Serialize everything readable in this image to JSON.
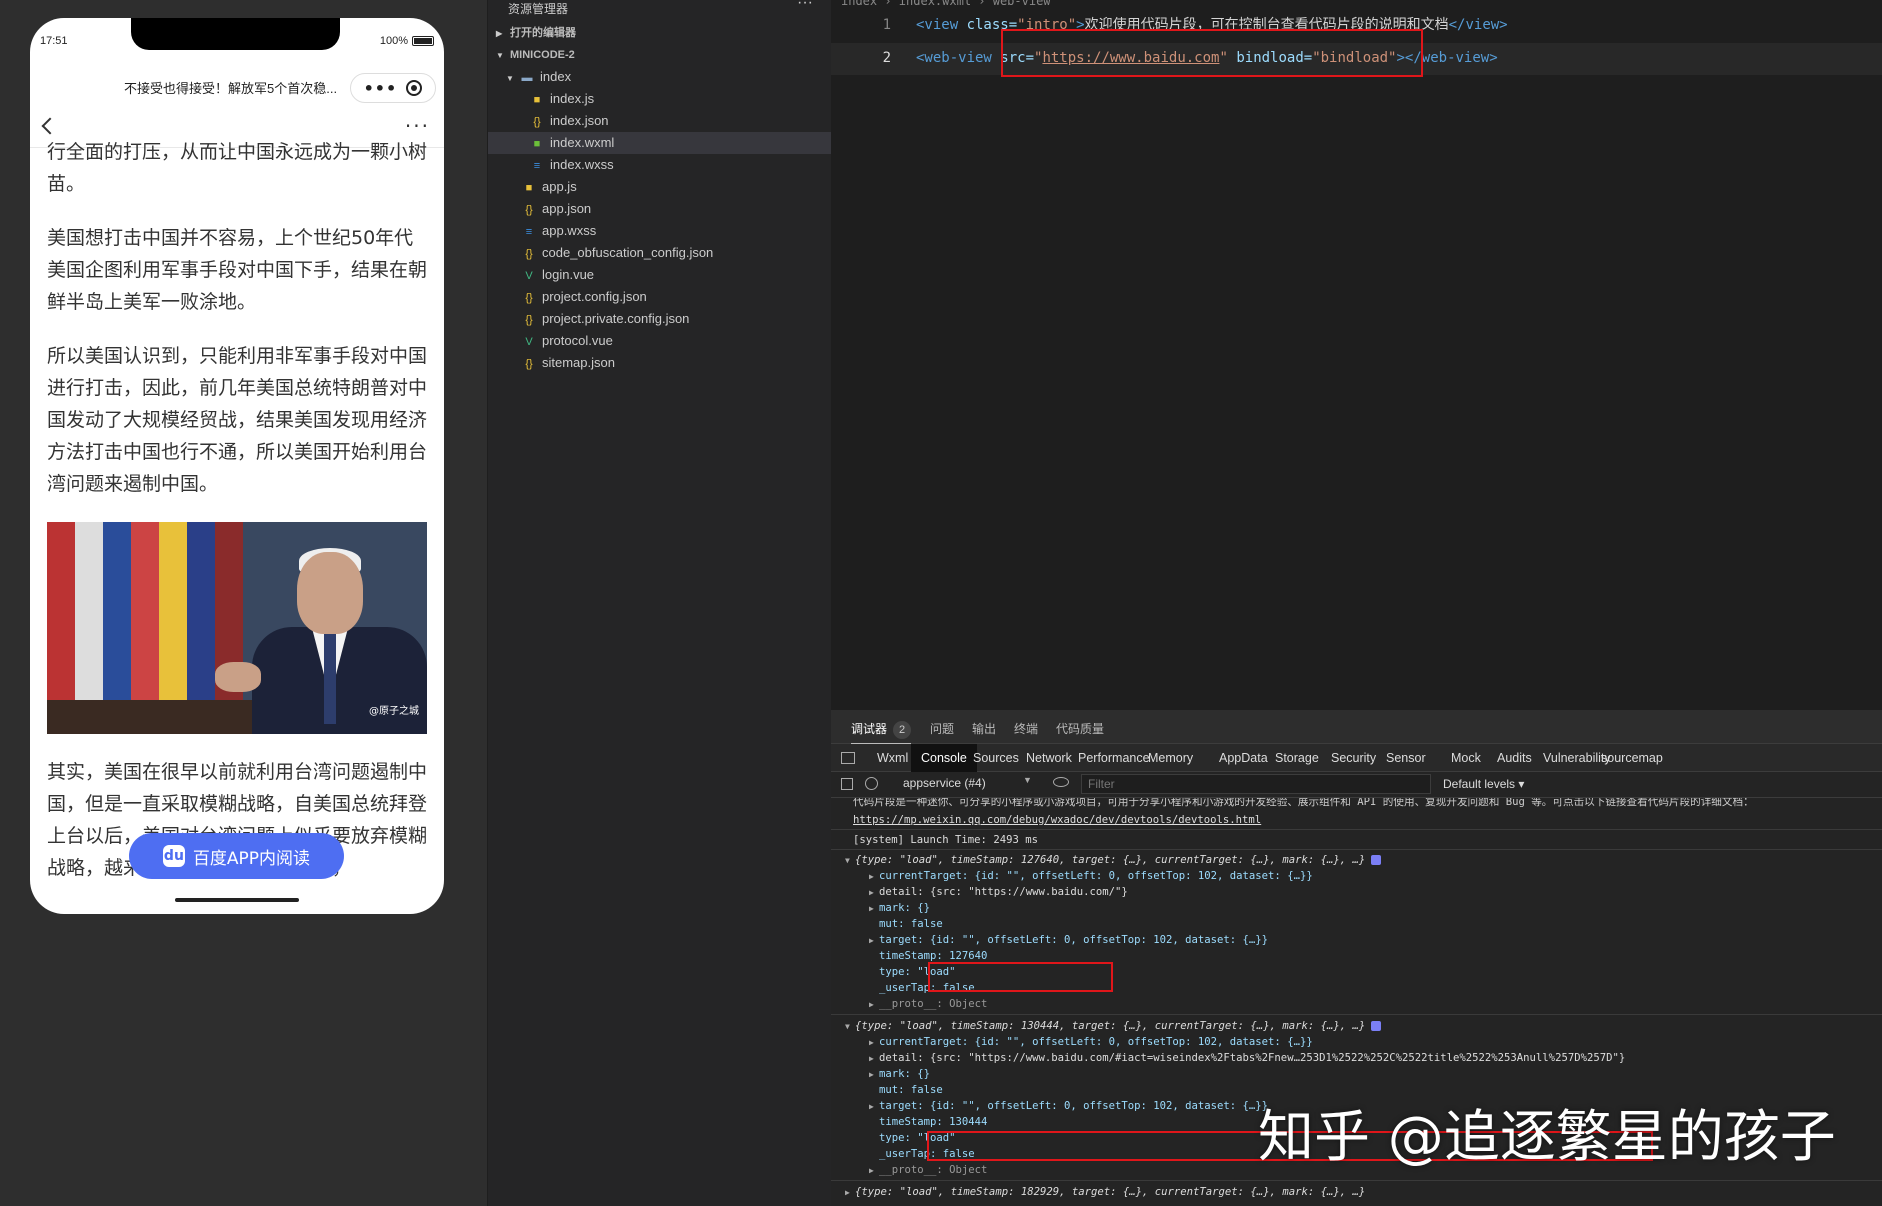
{
  "phone": {
    "status_time": "17:51",
    "battery": "100%",
    "miniprogram_title": "不接受也得接受！解放军5个首次稳...",
    "article_paragraphs": [
      "行全面的打压，从而让中国永远成为一颗小树苗。",
      "美国想打击中国并不容易，上个世纪50年代美国企图利用军事手段对中国下手，结果在朝鲜半岛上美军一败涂地。",
      "所以美国认识到，只能利用非军事手段对中国进行打击，因此，前几年美国总统特朗普对中国发动了大规模经贸战，结果美国发现用经济方法打击中国也行不通，所以美国开始利用台湾问题来遏制中国。"
    ],
    "photo_credit": "@原子之城",
    "article_after_photo": "其实，美国在很早以前就利用台湾问题遏制中国，但是一直采取模糊战略，自美国总统拜登上台以后，美国对台湾问题上似乎要放弃模糊战略，越来越倾向于阻止两岸统一，",
    "read_in_app": "百度APP内阅读"
  },
  "explorer": {
    "title": "资源管理器",
    "open_editors": "打开的编辑器",
    "project": "MINICODE-2",
    "items": [
      {
        "label": "index",
        "icon": "folder"
      },
      {
        "label": "index.js",
        "icon": "js"
      },
      {
        "label": "index.json",
        "icon": "json"
      },
      {
        "label": "index.wxml",
        "icon": "wxml"
      },
      {
        "label": "index.wxss",
        "icon": "wxss"
      },
      {
        "label": "app.js",
        "icon": "js"
      },
      {
        "label": "app.json",
        "icon": "json"
      },
      {
        "label": "app.wxss",
        "icon": "wxss"
      },
      {
        "label": "code_obfuscation_config.json",
        "icon": "json"
      },
      {
        "label": "login.vue",
        "icon": "vue"
      },
      {
        "label": "project.config.json",
        "icon": "json"
      },
      {
        "label": "project.private.config.json",
        "icon": "json"
      },
      {
        "label": "protocol.vue",
        "icon": "vue"
      },
      {
        "label": "sitemap.json",
        "icon": "json"
      }
    ]
  },
  "editor": {
    "breadcrumb": "index › index.wxml › web-view",
    "line1_no": "1",
    "line2_no": "2",
    "line1": {
      "open": "<view ",
      "attr": "class=",
      "val": "\"intro\"",
      "gt": ">",
      "text": "欢迎使用代码片段，可在控制台查看代码片段的说明和文档",
      "close": "</view>"
    },
    "line2": {
      "open": "<web-view ",
      "attr1": "src=",
      "q1": "\"",
      "url": "https://www.baidu.com",
      "q2": "\"",
      "attr2": " bindload=",
      "val2": "\"bindload\"",
      "close": "></web-view>"
    }
  },
  "devtools": {
    "top_tabs": {
      "debugger": "调试器",
      "badge": "2",
      "issues": "问题",
      "output": "输出",
      "terminal": "终端",
      "quality": "代码质量"
    },
    "panel_tabs": [
      "Wxml",
      "Console",
      "Sources",
      "Network",
      "Performance",
      "Memory",
      "AppData",
      "Storage",
      "Security",
      "Sensor",
      "Mock",
      "Audits",
      "Vulnerability",
      "sourcemap"
    ],
    "context": "appservice (#4)",
    "filter_placeholder": "Filter",
    "levels": "Default levels ▾",
    "console": {
      "intro": "代码片段是一种迷你、可分享的小程序或小游戏项目，可用于分享小程序和小游戏的开发经验、展示组件和 API 的使用、复现开发问题和 Bug 等。可点击以下链接查看代码片段的详细文档：",
      "link": "https://mp.weixin.qq.com/debug/wxadoc/dev/devtools/devtools.html",
      "launch": "[system] Launch Time: 2493 ms",
      "ev1_head": "{type: \"load\", timeStamp: 127640, target: {…}, currentTarget: {…}, mark: {…}, …}",
      "ev1_current": "currentTarget: {id: \"\", offsetLeft: 0, offsetTop: 102, dataset: {…}}",
      "ev1_detail": "detail: {src: \"https://www.baidu.com/\"}",
      "mark": "mark: {}",
      "mut": "mut: false",
      "ev1_target": "target: {id: \"\", offsetLeft: 0, offsetTop: 102, dataset: {…}}",
      "ev1_ts": "timeStamp: 127640",
      "type": "type: \"load\"",
      "usertap": "_userTap: false",
      "proto": "__proto__: Object",
      "ev2_head": "{type: \"load\", timeStamp: 130444, target: {…}, currentTarget: {…}, mark: {…}, …}",
      "ev2_current": "currentTarget: {id: \"\", offsetLeft: 0, offsetTop: 102, dataset: {…}}",
      "ev2_detail": "detail: {src: \"https://www.baidu.com/#iact=wiseindex%2Ftabs%2Fnew…253D1%2522%252C%2522title%2522%253Anull%257D%257D\"}",
      "ev2_target": "target: {id: \"\", offsetLeft: 0, offsetTop: 102, dataset: {…}}",
      "ev2_ts": "timeStamp: 130444",
      "ev3_head": "{type: \"load\", timeStamp: 182929, target: {…}, currentTarget: {…}, mark: {…}, …}"
    }
  },
  "watermark": "知乎 @追逐繁星的孩子"
}
